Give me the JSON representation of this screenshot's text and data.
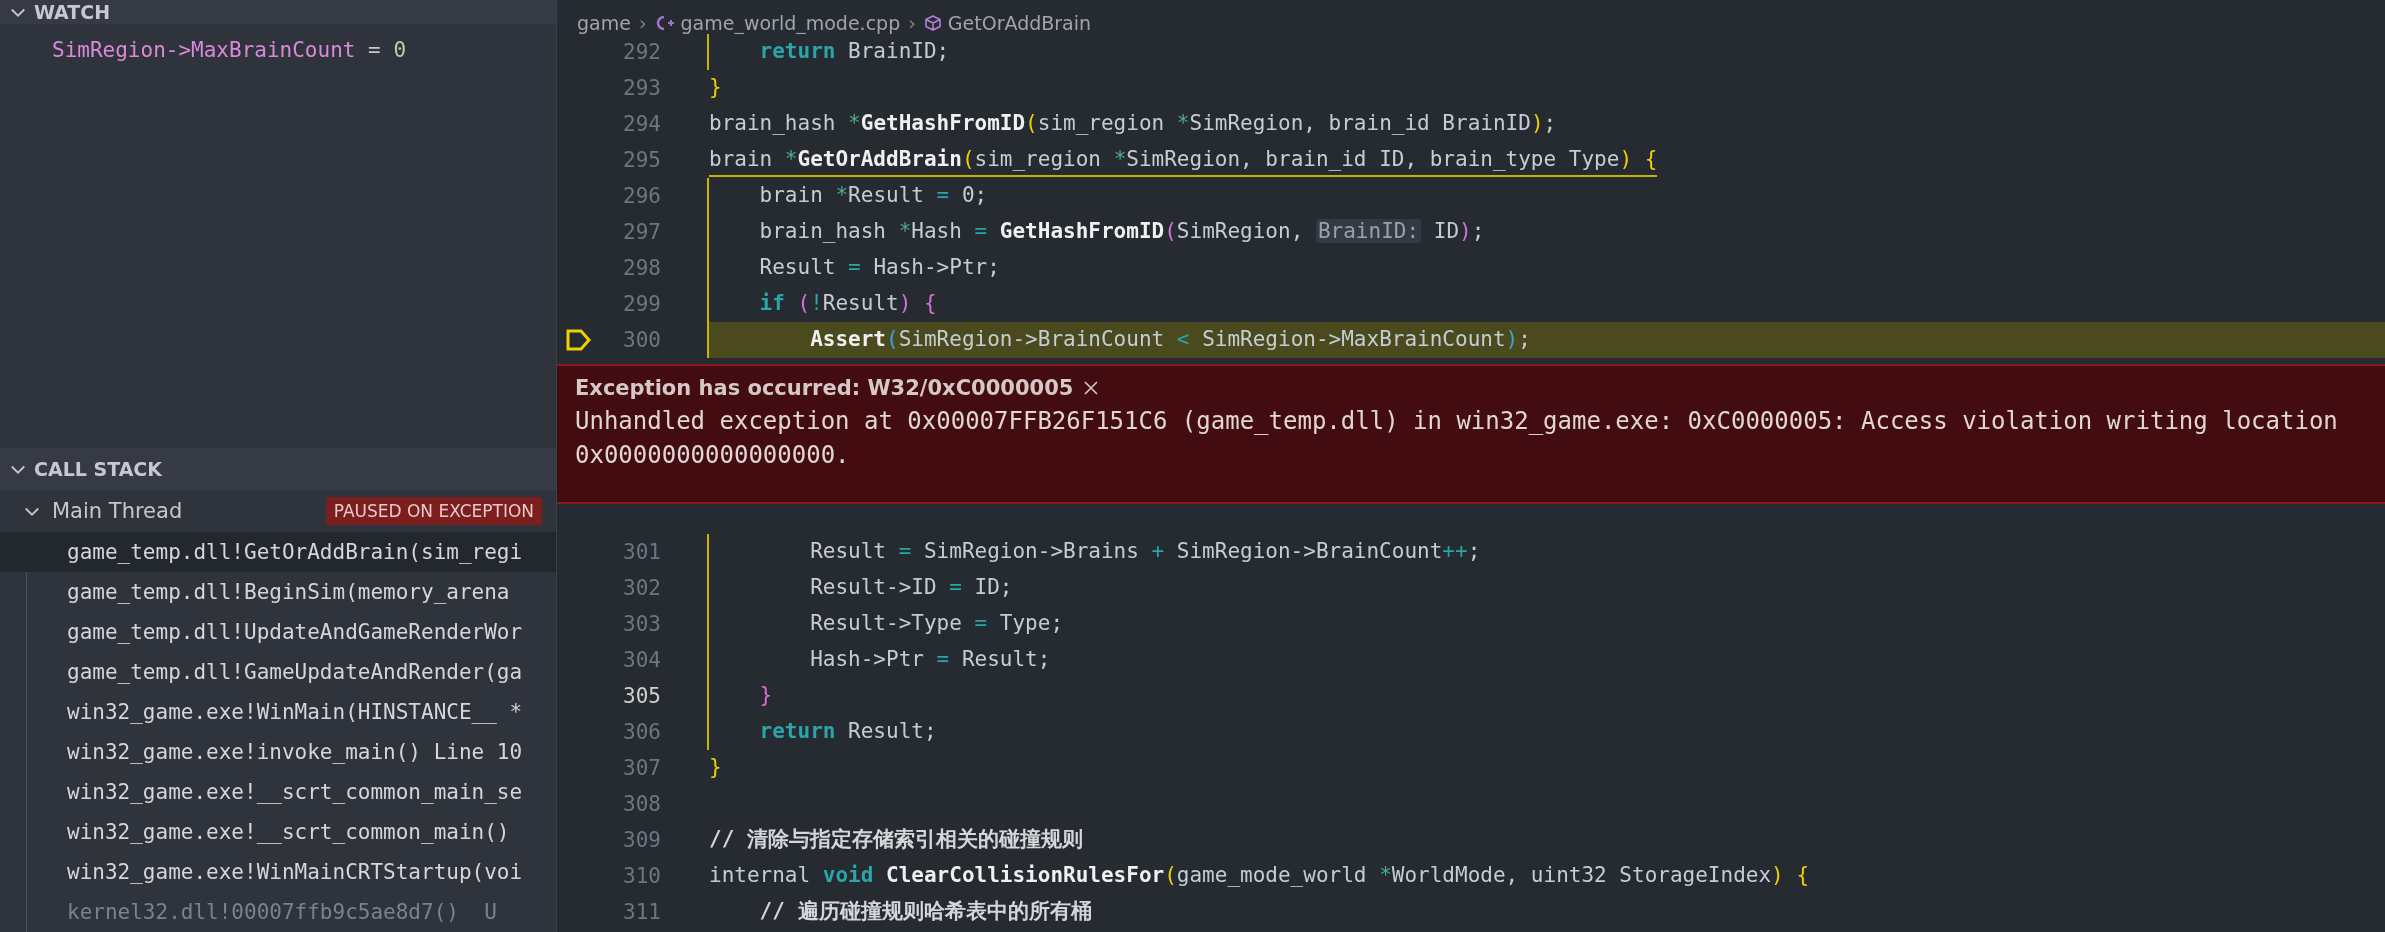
{
  "sidebar": {
    "watch": {
      "title": "WATCH",
      "expanded": true,
      "items": [
        {
          "expression": "SimRegion->MaxBrainCount",
          "operator": "=",
          "value": "0"
        }
      ]
    },
    "call_stack": {
      "title": "CALL STACK",
      "expanded": true,
      "thread": {
        "name": "Main Thread",
        "expanded": true,
        "badge": "PAUSED ON EXCEPTION"
      },
      "frames": [
        {
          "label": "game_temp.dll!GetOrAddBrain(sim_regi",
          "selected": true,
          "dimmed": false
        },
        {
          "label": "game_temp.dll!BeginSim(memory_arena",
          "selected": false,
          "dimmed": false
        },
        {
          "label": "game_temp.dll!UpdateAndGameRenderWor",
          "selected": false,
          "dimmed": false
        },
        {
          "label": "game_temp.dll!GameUpdateAndRender(ga",
          "selected": false,
          "dimmed": false
        },
        {
          "label": "win32_game.exe!WinMain(HINSTANCE__ *",
          "selected": false,
          "dimmed": false
        },
        {
          "label": "win32_game.exe!invoke_main() Line 10",
          "selected": false,
          "dimmed": false
        },
        {
          "label": "win32_game.exe!__scrt_common_main_se",
          "selected": false,
          "dimmed": false
        },
        {
          "label": "win32_game.exe!__scrt_common_main()",
          "selected": false,
          "dimmed": false
        },
        {
          "label": "win32_game.exe!WinMainCRTStartup(voi",
          "selected": false,
          "dimmed": false
        },
        {
          "label": "kernel32.dll!00007ffb9c5ae8d7()  U",
          "selected": false,
          "dimmed": true
        }
      ]
    }
  },
  "editor": {
    "breadcrumbs": [
      {
        "label": "game",
        "kind": "folder"
      },
      {
        "separator": "›",
        "label": "game_world_mode.cpp",
        "kind": "file"
      },
      {
        "separator": "›",
        "label": "GetOrAddBrain",
        "kind": "symbol"
      }
    ],
    "lines": [
      {
        "number": "292",
        "current": false,
        "cursor": false,
        "in_scope": true,
        "tokens": [
          {
            "text": "    return",
            "kind": "kw"
          },
          {
            "text": " BrainID;",
            "kind": "plain"
          }
        ]
      },
      {
        "number": "293",
        "current": false,
        "cursor": false,
        "in_scope": false,
        "tokens": [
          {
            "text": "}",
            "kind": "br1"
          }
        ]
      },
      {
        "number": "294",
        "current": false,
        "cursor": false,
        "in_scope": false,
        "tokens": [
          {
            "text": "brain_hash ",
            "kind": "plain"
          },
          {
            "text": "*",
            "kind": "ptr"
          },
          {
            "text": "GetHashFromID",
            "kind": "fn"
          },
          {
            "text": "(",
            "kind": "br1"
          },
          {
            "text": "sim_region ",
            "kind": "plain"
          },
          {
            "text": "*",
            "kind": "ptr"
          },
          {
            "text": "SimRegion, brain_id BrainID",
            "kind": "plain"
          },
          {
            "text": ")",
            "kind": "br1"
          },
          {
            "text": ";",
            "kind": "plain"
          }
        ]
      },
      {
        "number": "295",
        "current": false,
        "cursor": false,
        "in_scope": false,
        "underline": true,
        "tokens": [
          {
            "text": "brain ",
            "kind": "plain"
          },
          {
            "text": "*",
            "kind": "ptr"
          },
          {
            "text": "GetOrAddBrain",
            "kind": "fn"
          },
          {
            "text": "(",
            "kind": "br1"
          },
          {
            "text": "sim_region ",
            "kind": "plain"
          },
          {
            "text": "*",
            "kind": "ptr"
          },
          {
            "text": "SimRegion, brain_id ID, brain_type Type",
            "kind": "plain"
          },
          {
            "text": ")",
            "kind": "br1"
          },
          {
            "text": " {",
            "kind": "br1"
          }
        ]
      },
      {
        "number": "296",
        "current": false,
        "cursor": false,
        "in_scope": true,
        "tokens": [
          {
            "text": "    brain ",
            "kind": "plain"
          },
          {
            "text": "*",
            "kind": "ptr"
          },
          {
            "text": "Result ",
            "kind": "plain"
          },
          {
            "text": "=",
            "kind": "op"
          },
          {
            "text": " 0;",
            "kind": "plain"
          }
        ]
      },
      {
        "number": "297",
        "current": false,
        "cursor": false,
        "in_scope": true,
        "tokens": [
          {
            "text": "    brain_hash ",
            "kind": "plain"
          },
          {
            "text": "*",
            "kind": "ptr"
          },
          {
            "text": "Hash ",
            "kind": "plain"
          },
          {
            "text": "=",
            "kind": "op"
          },
          {
            "text": " GetHashFromID",
            "kind": "fn"
          },
          {
            "text": "(",
            "kind": "br2"
          },
          {
            "text": "SimRegion, ",
            "kind": "plain"
          },
          {
            "text": "BrainID:",
            "kind": "hint"
          },
          {
            "text": " ID",
            "kind": "plain"
          },
          {
            "text": ")",
            "kind": "br2"
          },
          {
            "text": ";",
            "kind": "plain"
          }
        ]
      },
      {
        "number": "298",
        "current": false,
        "cursor": false,
        "in_scope": true,
        "tokens": [
          {
            "text": "    Result ",
            "kind": "plain"
          },
          {
            "text": "=",
            "kind": "op"
          },
          {
            "text": " Hash->Ptr;",
            "kind": "plain"
          }
        ]
      },
      {
        "number": "299",
        "current": false,
        "cursor": false,
        "in_scope": true,
        "tokens": [
          {
            "text": "    if",
            "kind": "kw"
          },
          {
            "text": " (",
            "kind": "br2"
          },
          {
            "text": "!",
            "kind": "op"
          },
          {
            "text": "Result",
            "kind": "plain"
          },
          {
            "text": ")",
            "kind": "br2"
          },
          {
            "text": " {",
            "kind": "br2"
          }
        ]
      },
      {
        "number": "300",
        "current": true,
        "cursor": false,
        "in_scope": true,
        "tokens": [
          {
            "text": "        Assert",
            "kind": "fn"
          },
          {
            "text": "(",
            "kind": "br3"
          },
          {
            "text": "SimRegion->BrainCount ",
            "kind": "plain"
          },
          {
            "text": "<",
            "kind": "op"
          },
          {
            "text": " SimRegion->MaxBrainCount",
            "kind": "plain"
          },
          {
            "text": ")",
            "kind": "br3"
          },
          {
            "text": ";",
            "kind": "plain"
          }
        ]
      }
    ],
    "exception": {
      "title": "Exception has occurred: W32/0xC0000005",
      "message": "Unhandled exception at 0x00007FFB26F151C6 (game_temp.dll) in win32_game.exe: 0xC0000005: Access violation writing location 0x0000000000000000."
    },
    "lines_after": [
      {
        "number": "301",
        "current": false,
        "cursor": false,
        "in_scope": true,
        "tokens": [
          {
            "text": "        Result ",
            "kind": "plain"
          },
          {
            "text": "=",
            "kind": "op"
          },
          {
            "text": " SimRegion->Brains ",
            "kind": "plain"
          },
          {
            "text": "+",
            "kind": "op"
          },
          {
            "text": " SimRegion->BrainCount",
            "kind": "plain"
          },
          {
            "text": "++",
            "kind": "op"
          },
          {
            "text": ";",
            "kind": "plain"
          }
        ]
      },
      {
        "number": "302",
        "current": false,
        "cursor": false,
        "in_scope": true,
        "tokens": [
          {
            "text": "        Result->ID ",
            "kind": "plain"
          },
          {
            "text": "=",
            "kind": "op"
          },
          {
            "text": " ID;",
            "kind": "plain"
          }
        ]
      },
      {
        "number": "303",
        "current": false,
        "cursor": false,
        "in_scope": true,
        "tokens": [
          {
            "text": "        Result->Type ",
            "kind": "plain"
          },
          {
            "text": "=",
            "kind": "op"
          },
          {
            "text": " Type;",
            "kind": "plain"
          }
        ]
      },
      {
        "number": "304",
        "current": false,
        "cursor": false,
        "in_scope": true,
        "tokens": [
          {
            "text": "        Hash->Ptr ",
            "kind": "plain"
          },
          {
            "text": "=",
            "kind": "op"
          },
          {
            "text": " Result;",
            "kind": "plain"
          }
        ]
      },
      {
        "number": "305",
        "current": false,
        "cursor": true,
        "in_scope": true,
        "tokens": [
          {
            "text": "    }",
            "kind": "br2"
          }
        ]
      },
      {
        "number": "306",
        "current": false,
        "cursor": false,
        "in_scope": true,
        "tokens": [
          {
            "text": "    return",
            "kind": "kw"
          },
          {
            "text": " Result;",
            "kind": "plain"
          }
        ]
      },
      {
        "number": "307",
        "current": false,
        "cursor": false,
        "in_scope": false,
        "tokens": [
          {
            "text": "}",
            "kind": "br1"
          }
        ]
      },
      {
        "number": "308",
        "current": false,
        "cursor": false,
        "in_scope": false
      },
      {
        "number": "309",
        "current": false,
        "cursor": false,
        "in_scope": false,
        "tokens": [
          {
            "text": "// 清除与指定存储索引相关的碰撞规则",
            "kind": "comment"
          }
        ]
      },
      {
        "number": "310",
        "current": false,
        "cursor": false,
        "in_scope": false,
        "tokens": [
          {
            "text": "internal ",
            "kind": "plain"
          },
          {
            "text": "void",
            "kind": "kw"
          },
          {
            "text": " ClearCollisionRulesFor",
            "kind": "fn"
          },
          {
            "text": "(",
            "kind": "br1"
          },
          {
            "text": "game_mode_world ",
            "kind": "plain"
          },
          {
            "text": "*",
            "kind": "ptr"
          },
          {
            "text": "WorldMode, uint32 StorageIndex",
            "kind": "plain"
          },
          {
            "text": ")",
            "kind": "br1"
          },
          {
            "text": " {",
            "kind": "br1"
          }
        ]
      },
      {
        "number": "311",
        "current": false,
        "cursor": false,
        "in_scope": false,
        "tokens": [
          {
            "text": "    // 遍历碰撞规则哈希表中的所有桶",
            "kind": "comment"
          }
        ]
      }
    ]
  }
}
